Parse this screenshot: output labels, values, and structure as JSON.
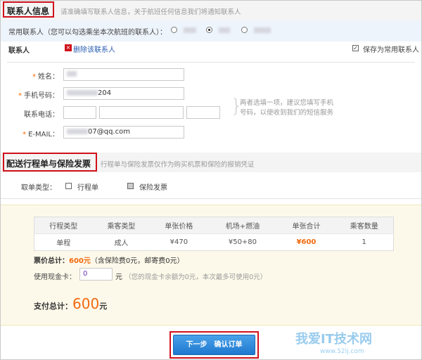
{
  "contact": {
    "title": "联系人信息",
    "hint": "请准确填写联系人信息，关于航班任何信息我们将通知联系人",
    "frequent_label": "常用联系人（您可以勾选乘坐本次航班的联系人）：",
    "contact_label": "联系人",
    "delete_label": "删除该联系人",
    "save_label": "保存为常用联系人",
    "name_label": "姓名：",
    "mobile_label": "手机号码：",
    "mobile_value": "204",
    "phone_label": "联系电话：",
    "email_label": "E-MAIL：",
    "email_value": "07@qq.com",
    "tip_line1": "两者选填一项，建议您填写手机",
    "tip_line2": "号码，以便收到我们的短信服务"
  },
  "delivery": {
    "title": "配送行程单与保险发票",
    "hint": "行程单与保险发票仅作为购买机票和保险的报销凭证",
    "type_label": "取单类型：",
    "opt1": "行程单",
    "opt2": "保险发票"
  },
  "price": {
    "headers": [
      "行程类型",
      "乘客类型",
      "单张价格",
      "机场+燃油",
      "单张合计",
      "乘客数量"
    ],
    "row": [
      "单程",
      "成人",
      "¥470",
      "¥50+80",
      "¥600",
      "1"
    ],
    "ticket_total_label": "票价总计：",
    "ticket_total": "600元",
    "ticket_total_note": "（含保险费0元，邮寄费0元）",
    "card_label": "使用现金卡：",
    "card_value": "0",
    "card_unit": "元",
    "card_note": "（您的现金卡余额为0元，本次最多可使用0元）",
    "pay_label": "支付总计：",
    "pay_amount": "600",
    "pay_unit": "元"
  },
  "button": {
    "next": "下一步　确认订单"
  },
  "watermark": {
    "name": "我爱IT技术网",
    "url": "www.52ij.com"
  },
  "colors": {
    "accent": "#f26a10",
    "highlight": "#d0111b",
    "button": "#2a86da"
  }
}
